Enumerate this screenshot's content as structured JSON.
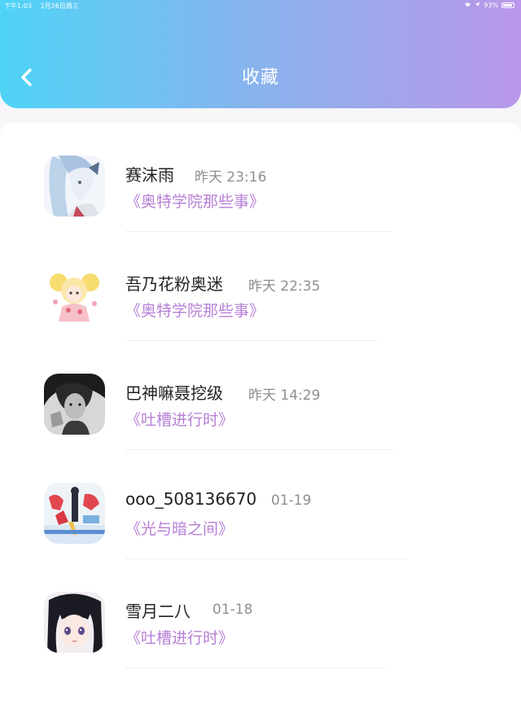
{
  "status_bar": {
    "time": "下午1:03",
    "date": "1月26日周三",
    "battery": "93%"
  },
  "header": {
    "title": "收藏"
  },
  "items": [
    {
      "name": "赛沫雨",
      "time": "昨天 23:16",
      "topic": "《奥特学院那些事》"
    },
    {
      "name": "吾乃花粉奥迷",
      "time": "昨天 22:35",
      "topic": "《奥特学院那些事》"
    },
    {
      "name": "巴神嘛聂挖级",
      "time": "昨天 14:29",
      "topic": "《吐槽进行时》"
    },
    {
      "name": "ooo_508136670",
      "time": "01-19",
      "topic": "《光与暗之间》"
    },
    {
      "name": "雪月二八",
      "time": "01-18",
      "topic": "《吐槽进行时》"
    }
  ],
  "colors": {
    "header_gradient_start": "#4fd3f7",
    "header_gradient_end": "#b996ea",
    "topic": "#b77fd6",
    "time": "#8e8e93"
  }
}
